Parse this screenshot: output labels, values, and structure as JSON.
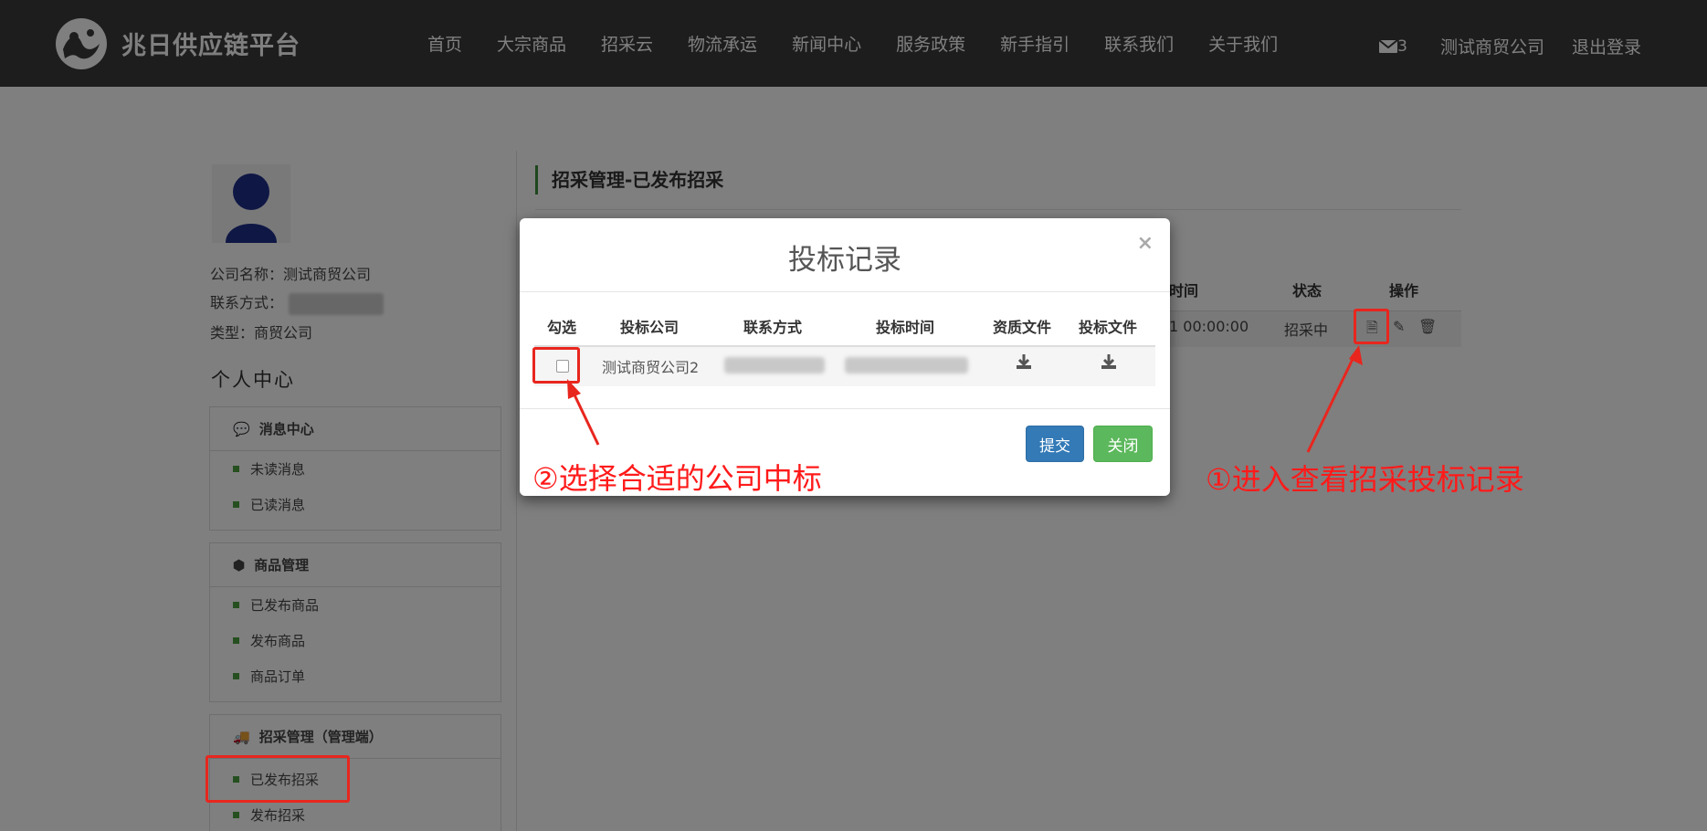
{
  "header": {
    "logo_text": "兆日供应链平台",
    "nav": [
      "首页",
      "大宗商品",
      "招采云",
      "物流承运",
      "新闻中心",
      "服务政策",
      "新手指引",
      "联系我们",
      "关于我们"
    ],
    "mail_count": "3",
    "company": "测试商贸公司",
    "logout": "退出登录"
  },
  "profile": {
    "company_line": "公司名称：测试商贸公司",
    "contact_label": "联系方式：",
    "type_line": "类型：商贸公司",
    "center_title": "个人中心"
  },
  "sidebar": {
    "messages": {
      "title": "消息中心",
      "items": [
        "未读消息",
        "已读消息"
      ]
    },
    "goods": {
      "title": "商品管理",
      "items": [
        "已发布商品",
        "发布商品",
        "商品订单"
      ]
    },
    "procure": {
      "title": "招采管理（管理端）",
      "items": [
        "已发布招采",
        "发布招采"
      ]
    }
  },
  "main": {
    "title": "招采管理-已发布招采",
    "table_headers": [
      "时间",
      "状态",
      "操作"
    ],
    "row": {
      "time": "1 00:00:00",
      "status": "招采中"
    }
  },
  "modal": {
    "title": "投标记录",
    "close": "×",
    "headers": [
      "勾选",
      "投标公司",
      "联系方式",
      "投标时间",
      "资质文件",
      "投标文件"
    ],
    "rows": [
      {
        "company": "测试商贸公司2"
      }
    ],
    "submit": "提交",
    "close_button": "关闭"
  },
  "annotations": {
    "step1": "①进入查看招采投标记录",
    "step2": "②选择合适的公司中标",
    "color": "#ff1a1a"
  },
  "colors": {
    "header_bg": "#3a3a3a",
    "accent_green": "#4a9f3f",
    "primary_blue": "#337ab7",
    "success_green": "#5cb85c"
  }
}
